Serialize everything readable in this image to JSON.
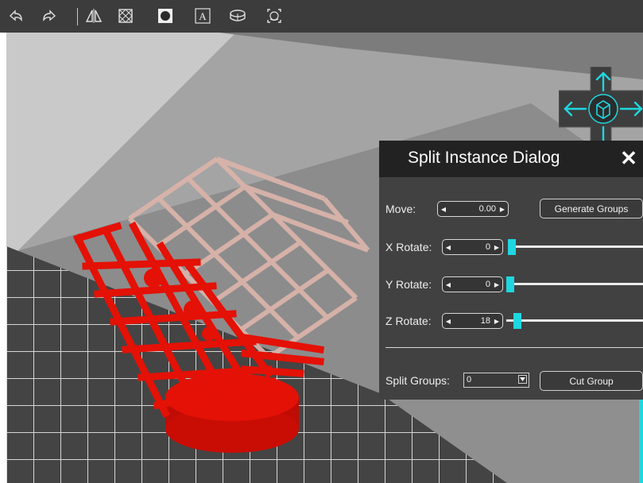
{
  "toolbar": {
    "buttons": [
      {
        "icon": "undo-icon"
      },
      {
        "icon": "redo-icon"
      },
      {
        "icon": "mirror-icon"
      },
      {
        "icon": "crossed-box-icon"
      },
      {
        "icon": "filled-circle-icon"
      },
      {
        "icon": "text-a-icon"
      },
      {
        "icon": "disk-icon"
      },
      {
        "icon": "auto-arrange-icon"
      }
    ]
  },
  "dialog": {
    "title": "Split Instance Dialog",
    "close": "✕",
    "move": {
      "label": "Move:",
      "value": "0.00"
    },
    "generate_groups": "Generate Groups",
    "x_rotate": {
      "label": "X Rotate:",
      "value": "0",
      "slider_fraction": 0.0
    },
    "y_rotate": {
      "label": "Y Rotate:",
      "value": "0",
      "slider_fraction": 0.0
    },
    "z_rotate": {
      "label": "Z Rotate:",
      "value": "18",
      "slider_fraction": 0.05
    },
    "split_groups": {
      "label": "Split Groups:",
      "value": "0"
    },
    "cut_group": "Cut Group"
  },
  "colors": {
    "accent": "#1fd7e0",
    "model_red": "#e41106",
    "model_ghost": "#d9b3aa",
    "dialog_bg": "#414141",
    "dialog_header": "#222222",
    "toolbar_bg": "#3c3c3c"
  }
}
